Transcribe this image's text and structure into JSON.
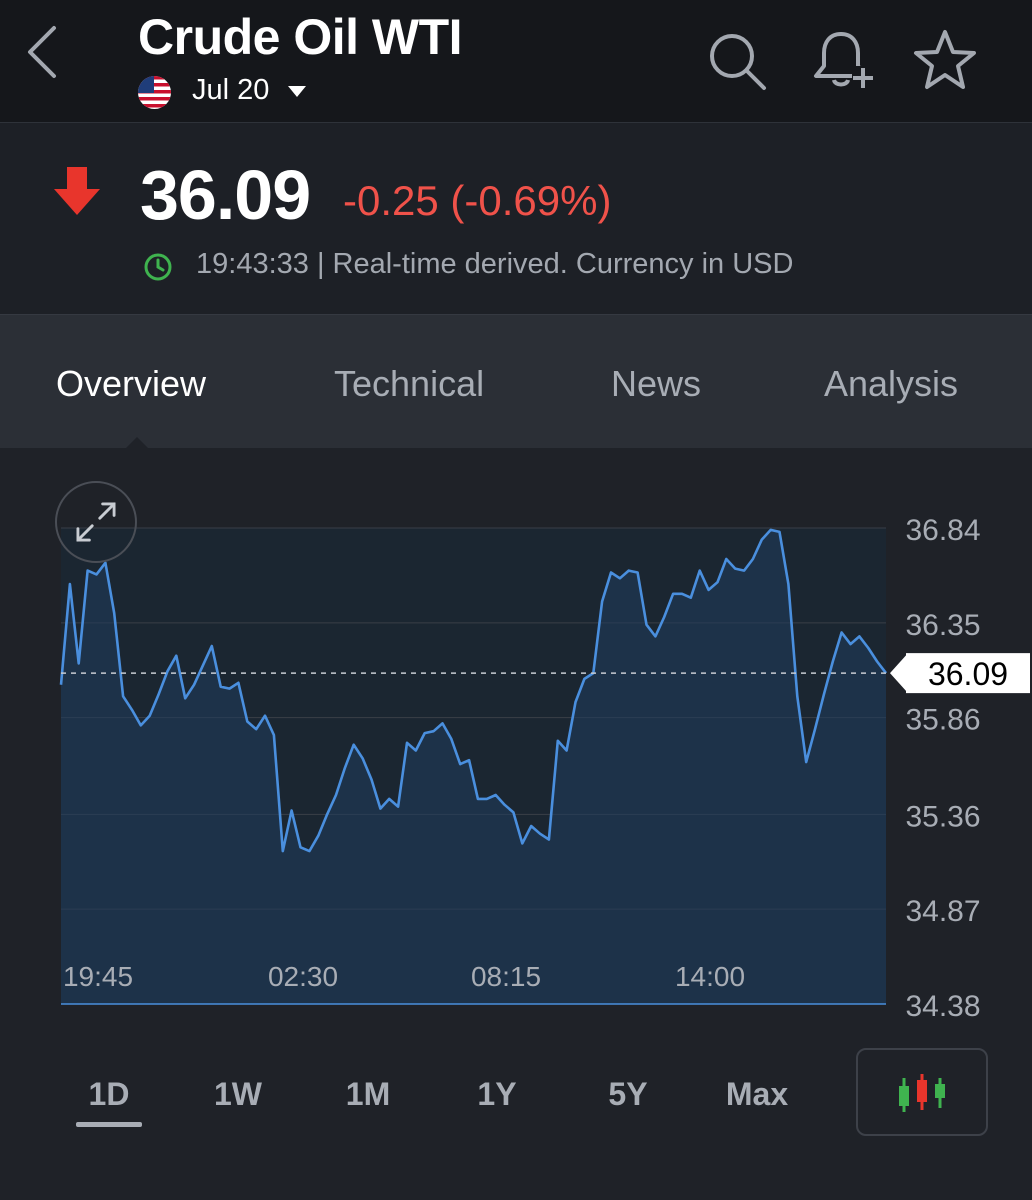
{
  "header": {
    "title": "Crude Oil WTI",
    "contract_label": "Jul 20",
    "icons": [
      "back-icon",
      "search-icon",
      "add-alert-icon",
      "star-icon"
    ]
  },
  "quote": {
    "price": "36.09",
    "change_text": "-0.25 (-0.69%)",
    "meta": "19:43:33 | Real-time derived. Currency in USD",
    "change_color": "#f0524a",
    "direction": "down"
  },
  "tabs": [
    {
      "label": "Overview",
      "active": true
    },
    {
      "label": "Technical",
      "active": false
    },
    {
      "label": "News",
      "active": false
    },
    {
      "label": "Analysis",
      "active": false
    }
  ],
  "ranges": [
    {
      "label": "1D",
      "active": true
    },
    {
      "label": "1W",
      "active": false
    },
    {
      "label": "1M",
      "active": false
    },
    {
      "label": "1Y",
      "active": false
    },
    {
      "label": "5Y",
      "active": false
    },
    {
      "label": "Max",
      "active": false
    }
  ],
  "chart_data": {
    "type": "area",
    "ylim": [
      34.38,
      36.84
    ],
    "yticks": [
      "36.84",
      "36.35",
      "35.86",
      "35.36",
      "34.87",
      "34.38"
    ],
    "xticks": [
      "19:45",
      "02:30",
      "08:15",
      "14:00"
    ],
    "last_value": 36.09,
    "last_value_label": "36.09",
    "line_color": "#4a8fde",
    "grid": true,
    "series": [
      {
        "values": [
          36.03,
          36.55,
          36.14,
          36.62,
          36.6,
          36.66,
          36.4,
          35.97,
          35.9,
          35.82,
          35.87,
          35.98,
          36.1,
          36.18,
          35.96,
          36.03,
          36.13,
          36.23,
          36.02,
          36.01,
          36.04,
          35.84,
          35.8,
          35.87,
          35.77,
          35.17,
          35.38,
          35.19,
          35.17,
          35.25,
          35.36,
          35.46,
          35.6,
          35.72,
          35.65,
          35.54,
          35.39,
          35.44,
          35.4,
          35.73,
          35.69,
          35.78,
          35.79,
          35.83,
          35.75,
          35.62,
          35.64,
          35.44,
          35.44,
          35.46,
          35.41,
          35.37,
          35.21,
          35.3,
          35.26,
          35.23,
          35.74,
          35.69,
          35.94,
          36.06,
          36.09,
          36.46,
          36.61,
          36.58,
          36.62,
          36.61,
          36.34,
          36.28,
          36.38,
          36.5,
          36.5,
          36.48,
          36.62,
          36.52,
          36.56,
          36.68,
          36.63,
          36.62,
          36.68,
          36.78,
          36.83,
          36.82,
          36.55,
          35.97,
          35.63,
          35.8,
          35.98,
          36.15,
          36.3,
          36.24,
          36.28,
          36.22,
          36.15,
          36.09
        ]
      }
    ]
  }
}
